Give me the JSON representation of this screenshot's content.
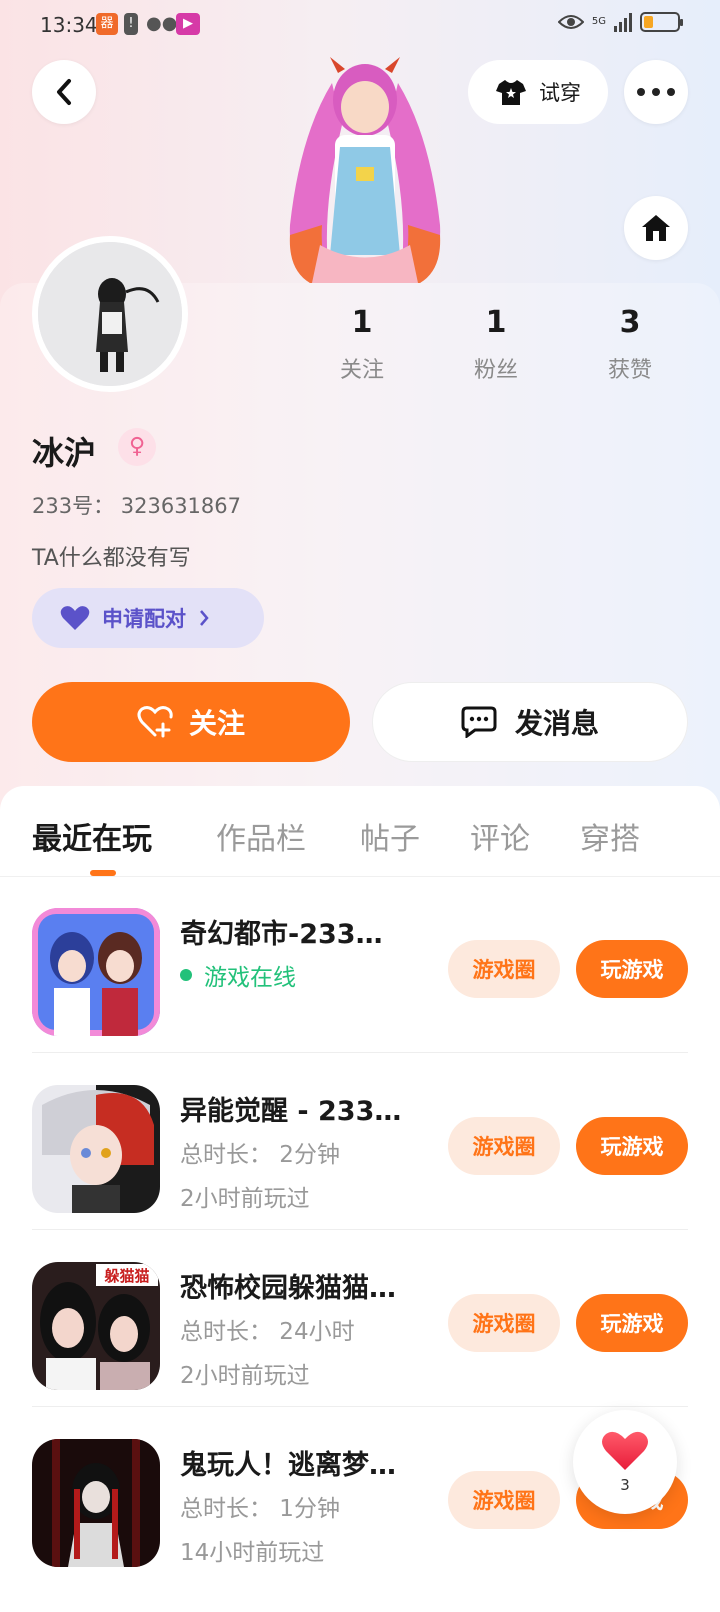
{
  "status_bar": {
    "time": "13:34",
    "network": "5G"
  },
  "header": {
    "tryon_label": "试穿"
  },
  "profile": {
    "stats": [
      {
        "value": "1",
        "label": "关注"
      },
      {
        "value": "1",
        "label": "粉丝"
      },
      {
        "value": "3",
        "label": "获赞"
      }
    ],
    "username": "冰沪",
    "gender_symbol": "♀",
    "uid": "233号： 323631867",
    "bio": "TA什么都没有写",
    "pair_label": "申请配对",
    "follow_label": "关注",
    "message_label": "发消息"
  },
  "tabs": [
    {
      "label": "最近在玩",
      "active": true
    },
    {
      "label": "作品栏",
      "active": false
    },
    {
      "label": "帖子",
      "active": false
    },
    {
      "label": "评论",
      "active": false
    },
    {
      "label": "穿搭",
      "active": false
    }
  ],
  "games": [
    {
      "title": "奇幻都市-233…",
      "line1": "游戏在线",
      "line2": "",
      "online": true,
      "circle_label": "游戏圈",
      "play_label": "玩游戏"
    },
    {
      "title": "异能觉醒 - 233…",
      "line1": "总时长： 2分钟",
      "line2": "2小时前玩过",
      "online": false,
      "circle_label": "游戏圈",
      "play_label": "玩游戏"
    },
    {
      "title": "恐怖校园躲猫猫…",
      "line1": "总时长： 24小时",
      "line2": "2小时前玩过",
      "online": false,
      "circle_label": "游戏圈",
      "play_label": "玩游戏"
    },
    {
      "title": "鬼玩人！逃离梦…",
      "line1": "总时长： 1分钟",
      "line2": "14小时前玩过",
      "online": false,
      "circle_label": "游戏圈",
      "play_label": "玩游戏"
    }
  ],
  "game3_icon_text": "躲猫猫",
  "floating_like": {
    "count": "3"
  },
  "colors": {
    "accent": "#ff7418",
    "online": "#22c17a",
    "pair": "#5b52c9"
  }
}
